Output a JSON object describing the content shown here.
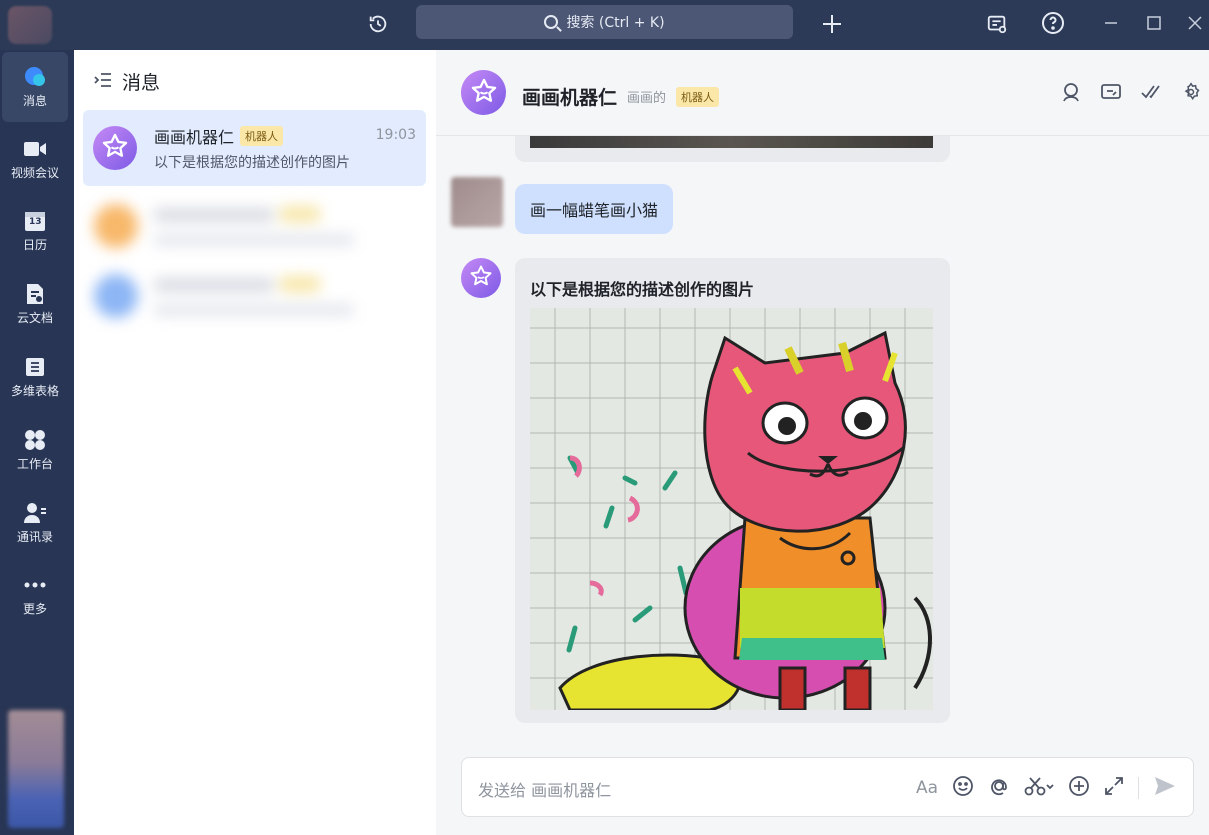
{
  "topbar": {
    "search_placeholder": "搜索 (Ctrl + K)",
    "icons": [
      "history-icon",
      "add-icon",
      "announcement-icon",
      "help-icon",
      "minimize-icon",
      "maximize-icon",
      "close-icon"
    ]
  },
  "sidebar": {
    "items": [
      {
        "label": "消息",
        "icon": "chat-bubble-icon"
      },
      {
        "label": "视频会议",
        "icon": "video-camera-icon"
      },
      {
        "label": "日历",
        "icon": "calendar-icon"
      },
      {
        "label": "云文档",
        "icon": "document-icon"
      },
      {
        "label": "多维表格",
        "icon": "table-icon"
      },
      {
        "label": "工作台",
        "icon": "grid-icon"
      },
      {
        "label": "通讯录",
        "icon": "contacts-icon"
      },
      {
        "label": "更多",
        "icon": "more-icon"
      }
    ],
    "calendar_day": "13"
  },
  "conversations": {
    "header": "消息",
    "active": {
      "name": "画画机器仁",
      "tag": "机器人",
      "time": "19:03",
      "preview": "以下是根据您的描述创作的图片"
    }
  },
  "chat": {
    "title": "画画机器仁",
    "subtitle": "画画的",
    "tag": "机器人",
    "messages": {
      "user_text": "画一幅蜡笔画小猫",
      "bot_caption": "以下是根据您的描述创作的图片"
    },
    "composer_placeholder": "发送给 画画机器仁",
    "font_button_label": "Aa"
  },
  "colors": {
    "titlebar": "#2c3a57",
    "rail": "#283554",
    "active_conversation": "#e2ecfe",
    "user_bubble": "#cfe0fe",
    "bot_tag_bg": "#fbe7a8",
    "bot_avatar": "#a36ef0"
  }
}
